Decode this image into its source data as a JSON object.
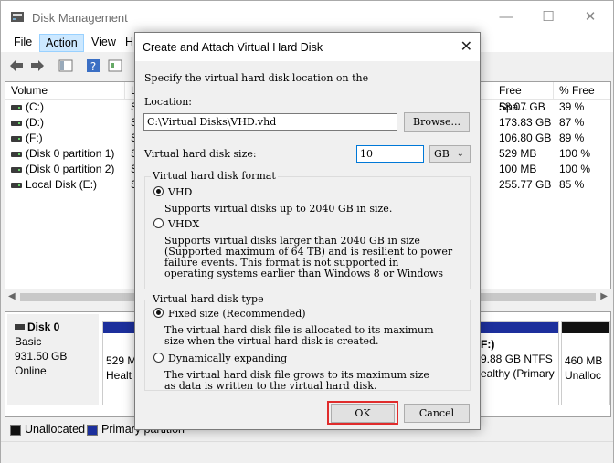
{
  "window": {
    "title": "Disk Management",
    "minimize": "—",
    "maximize": "☐",
    "close": "✕"
  },
  "menu": {
    "file": "File",
    "action": "Action",
    "view": "View",
    "help_partial": "H"
  },
  "volume_list": {
    "columns": [
      "Volume",
      "L",
      "Free Spa...",
      "% Free"
    ],
    "rows": [
      {
        "volume": "(C:)",
        "layout": "S",
        "free": "58.07 GB",
        "pct": "39 %"
      },
      {
        "volume": "(D:)",
        "layout": "S",
        "free": "173.83 GB",
        "pct": "87 %"
      },
      {
        "volume": "(F:)",
        "layout": "S",
        "free": "106.80 GB",
        "pct": "89 %"
      },
      {
        "volume": "(Disk 0 partition 1)",
        "layout": "S",
        "free": "529 MB",
        "pct": "100 %"
      },
      {
        "volume": "(Disk 0 partition 2)",
        "layout": "S",
        "free": "100 MB",
        "pct": "100 %"
      },
      {
        "volume": "Local Disk  (E:)",
        "layout": "S",
        "free": "255.77 GB",
        "pct": "85 %"
      }
    ]
  },
  "disk": {
    "name": "Disk 0",
    "type": "Basic",
    "size": "931.50 GB",
    "status": "Online",
    "partitions": [
      {
        "line1": "529 M",
        "line2": "Healt"
      },
      {
        "line1": "F:)",
        "line2": "9.88 GB NTFS",
        "line3": "ealthy (Primary"
      },
      {
        "line1": "460 MB",
        "line2": "Unalloc"
      }
    ]
  },
  "legend": {
    "unallocated": "Unallocated",
    "primary": "Primary partition"
  },
  "dialog": {
    "title": "Create and Attach Virtual Hard Disk",
    "close": "✕",
    "intro": "Specify the virtual hard disk location on the",
    "location_label": "Location:",
    "location_value": "C:\\Virtual Disks\\VHD.vhd",
    "browse": "Browse...",
    "size_label": "Virtual hard disk size:",
    "size_value": "10",
    "unit": "GB",
    "format_group": "Virtual hard disk format",
    "vhd_label": "VHD",
    "vhd_desc": "Supports virtual disks up to 2040 GB in size.",
    "vhdx_label": "VHDX",
    "vhdx_desc": [
      "Supports virtual disks larger than 2040 GB in size",
      "(Supported maximum of 64 TB) and is resilient to power",
      "failure events. This format is not supported in",
      "operating systems earlier than Windows 8 or Windows"
    ],
    "type_group": "Virtual hard disk type",
    "fixed_label": "Fixed size (Recommended)",
    "fixed_desc": [
      "The virtual hard disk file is allocated to its maximum",
      "size when the virtual hard disk is created."
    ],
    "dynamic_label": "Dynamically expanding",
    "dynamic_desc": [
      "The virtual hard disk file grows to its maximum size",
      "as data is written to the virtual hard disk."
    ],
    "ok": "OK",
    "cancel": "Cancel"
  },
  "colors": {
    "primary_partition": "#1c2f9c",
    "unallocated": "#111111",
    "highlight": "#e02c2c"
  }
}
